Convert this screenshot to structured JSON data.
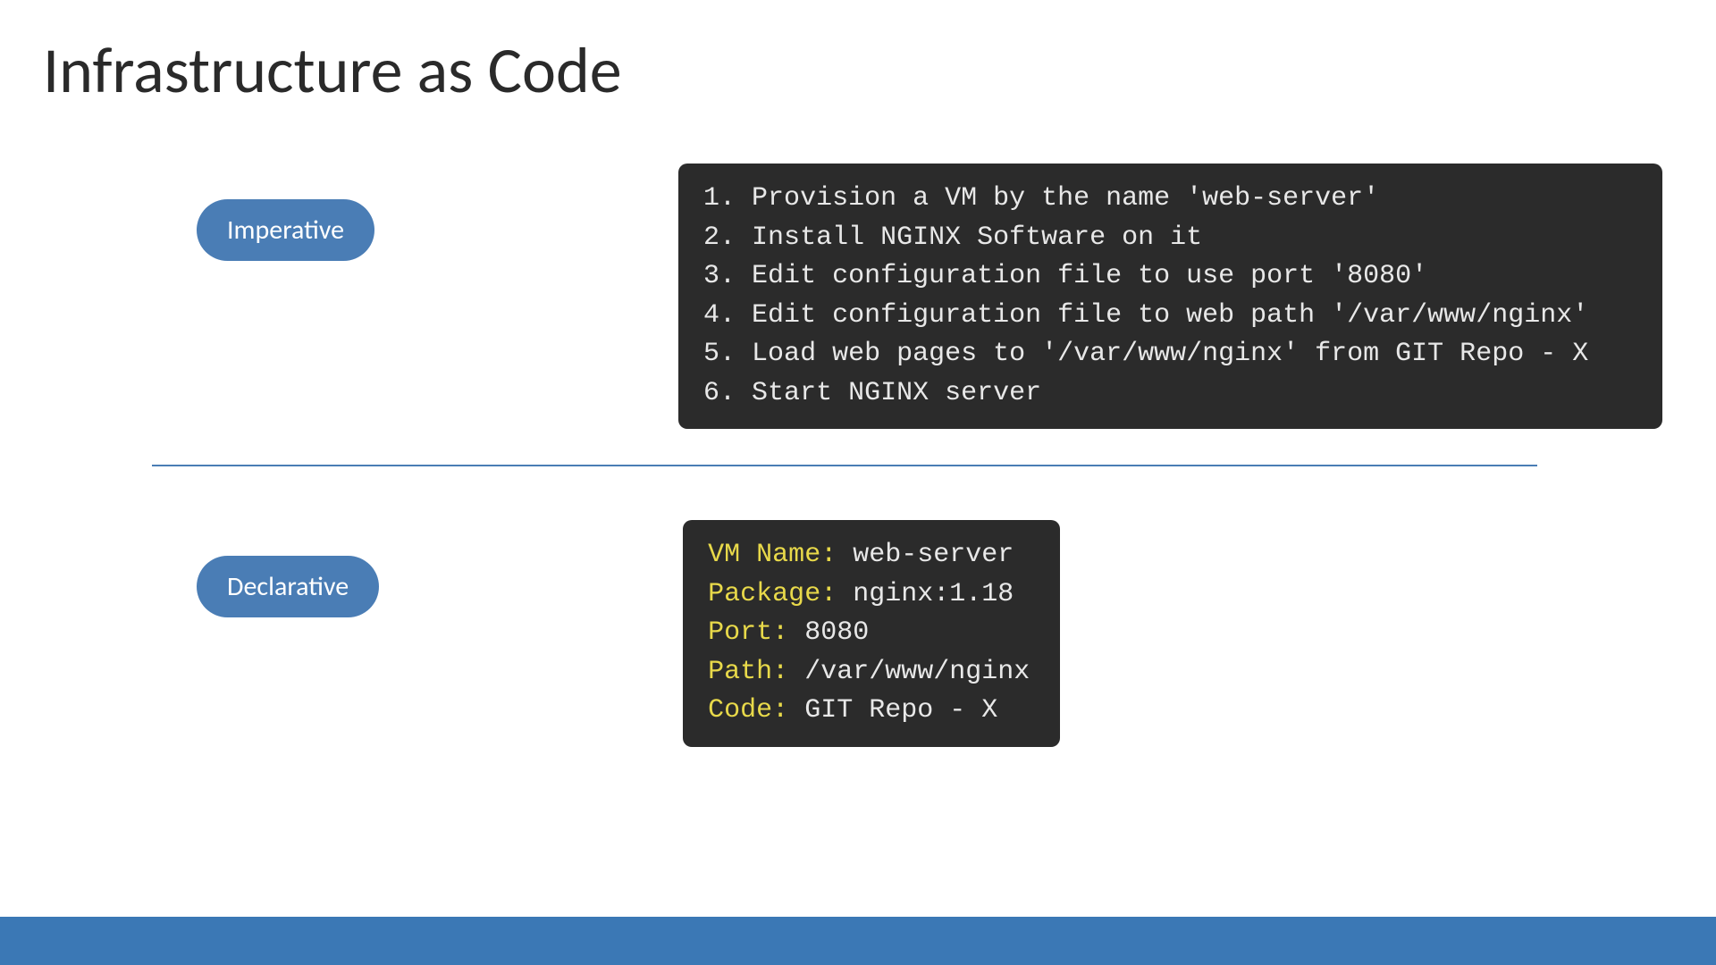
{
  "title": "Infrastructure as Code",
  "imperative": {
    "label": "Imperative",
    "lines": [
      "1. Provision a VM by the name 'web-server'",
      "2. Install NGINX Software on it",
      "3. Edit configuration file to use port '8080'",
      "4. Edit configuration file to web path '/var/www/nginx'",
      "5. Load web pages to '/var/www/nginx' from GIT Repo - X",
      "6. Start NGINX server"
    ]
  },
  "declarative": {
    "label": "Declarative",
    "kv": [
      {
        "key": "VM Name:",
        "val": " web-server"
      },
      {
        "key": "Package:",
        "val": "  nginx:1.18"
      },
      {
        "key": "Port:",
        "val": " 8080"
      },
      {
        "key": "Path:",
        "val": " /var/www/nginx"
      },
      {
        "key": "Code:",
        "val": " GIT Repo - X"
      }
    ]
  }
}
